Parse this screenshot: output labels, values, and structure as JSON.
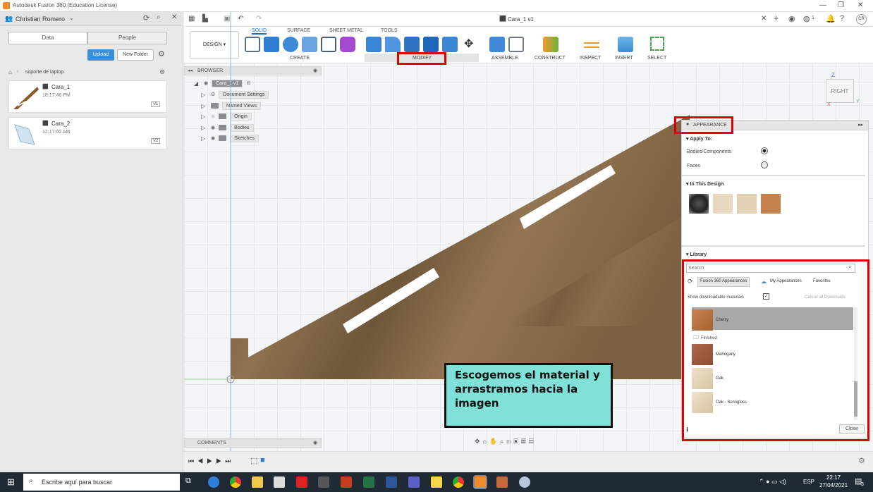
{
  "window": {
    "title": "Autodesk Fusion 360 (Education License)",
    "doc_tab": "Cara_1 v1",
    "user_initials": "CR",
    "notif_count": "1"
  },
  "data_panel": {
    "user": "Christian Romero",
    "tabs": [
      "Data",
      "People"
    ],
    "upload": "Upload",
    "new_folder": "New Folder",
    "breadcrumb": "soporte de laptop",
    "files": [
      {
        "name": "Cara_1",
        "time": "18:17:46 PM",
        "version": "V1"
      },
      {
        "name": "Cara_2",
        "time": "12:17:02 AM",
        "version": "V2"
      }
    ]
  },
  "toolbar": {
    "design": "DESIGN",
    "tabs": [
      "SOLID",
      "SURFACE",
      "SHEET METAL",
      "TOOLS"
    ],
    "groups": [
      "CREATE",
      "MODIFY",
      "ASSEMBLE",
      "CONSTRUCT",
      "INSPECT",
      "INSERT",
      "SELECT"
    ]
  },
  "browser": {
    "title": "BROWSER",
    "root": "Cara_1 v1",
    "items": [
      "Document Settings",
      "Named Views",
      "Origin",
      "Bodies",
      "Sketches"
    ]
  },
  "viewcube": {
    "label": "RIGHT",
    "z": "Z",
    "y": "Y",
    "x": "X"
  },
  "appearance": {
    "title": "APPEARANCE",
    "apply_to": "Apply To:",
    "option_bodies": "Bodies/Components",
    "option_faces": "Faces",
    "in_design": "In This Design",
    "library": "Library",
    "search_placeholder": "Search",
    "lib_tabs": [
      "Fusion 360 Appearances",
      "My Appearances",
      "Favorites"
    ],
    "show_downloadable": "Show downloadable materials",
    "cancel_downloads": "Cancel all Downloads",
    "folder": "Finished",
    "materials": [
      "Cherry",
      "Mahogany",
      "Oak",
      "Oak - Semigloss"
    ],
    "close": "Close",
    "colors": {
      "cherry": "#b8733f",
      "mahogany": "#9b5a3a",
      "oak": "#e2d4b8",
      "highlight": "#a8a8a8"
    }
  },
  "comments": {
    "title": "COMMENTS"
  },
  "callout": {
    "text": "Escogemos el material y arrastramos hacia la imagen",
    "bg": "#7fe1d8"
  },
  "taskbar": {
    "search": "Escribe aquí para buscar",
    "lang": "ESP",
    "time": "22:17",
    "date": "27/04/2021",
    "notif": "3"
  }
}
